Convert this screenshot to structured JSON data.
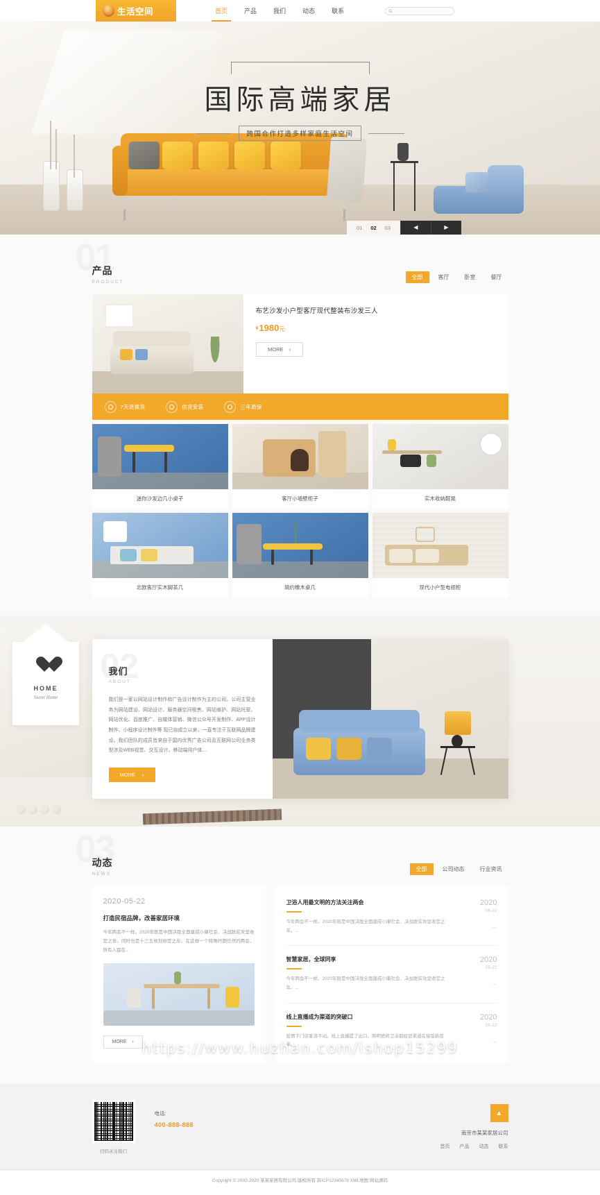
{
  "header": {
    "logo_text": "生活空间",
    "nav": [
      {
        "label": "首页",
        "active": true
      },
      {
        "label": "产品",
        "active": false
      },
      {
        "label": "我们",
        "active": false
      },
      {
        "label": "动态",
        "active": false
      },
      {
        "label": "联系",
        "active": false
      }
    ],
    "search_placeholder": ""
  },
  "hero": {
    "title": "国际高端家居",
    "subtitle": "跨国合作打造多样家庭生活空间",
    "carousel": {
      "slides": [
        "01",
        "02",
        "03"
      ],
      "active": "02",
      "prev_label": "◀",
      "next_label": "▶"
    }
  },
  "product": {
    "ghost": "01",
    "cn": "产品",
    "en": "PRODUCT",
    "tabs": [
      {
        "label": "全部",
        "active": true
      },
      {
        "label": "客厅",
        "active": false
      },
      {
        "label": "卧室",
        "active": false
      },
      {
        "label": "餐厅",
        "active": false
      }
    ],
    "featured": {
      "title": "布艺沙发小户型客厅现代整装布沙发三人",
      "currency": "¥",
      "price": "1980",
      "unit": "元",
      "more_label": "MORE",
      "more_arrow": "›"
    },
    "features": [
      {
        "label": "7天退换货"
      },
      {
        "label": "供货安装"
      },
      {
        "label": "三年质保"
      }
    ],
    "items": [
      {
        "caption": "迷你沙发边几小桌子"
      },
      {
        "caption": "客厅小墙壁柜子"
      },
      {
        "caption": "实木收纳鞋凳"
      },
      {
        "caption": "北欧客厅实木脚茶几"
      },
      {
        "caption": "简约橡木桌几"
      },
      {
        "caption": "现代小户型电视柜"
      }
    ]
  },
  "about": {
    "ghost": "02",
    "cn": "我们",
    "en": "ABOUT",
    "text": "我们是一家以网站设计制作和广告设计制作为主的公司。公司主营业务为网站建设、网站设计、服务器空间租售、网站维护、网站托管、网站优化、百度推广、自媒体营销、微信公众号开发制作、APP设计制作、小程序设计制作等 现已自成立以来，一直专注于互联网品牌建设。我们团队的成员皆来自于国内优秀广告公司及互联网公司业务类型涉及WEB视觉、交互设计、移动端用户体...",
    "more_label": "MORE",
    "more_arrow": "›",
    "deco": {
      "home": "HOME",
      "sweet": "Sweet Home"
    }
  },
  "news": {
    "ghost": "03",
    "cn": "动态",
    "en": "NEWS",
    "tabs": [
      {
        "label": "全部",
        "active": true
      },
      {
        "label": "公司动态",
        "active": false
      },
      {
        "label": "行业资讯",
        "active": false
      }
    ],
    "featured": {
      "date": "2020-05-22",
      "title": "打造民宿品牌，改善家居环境",
      "desc": "今年两会不一样。2020年既是中国决胜全面建成小康社会、决战脱贫攻坚收官之年，同时也是十三五规划收官之年。在这样一个特殊时期任然的两会，所有人都在...",
      "more_label": "MORE",
      "more_arrow": "›"
    },
    "items": [
      {
        "title": "卫浴人用最文明的方法关注两会",
        "desc": "今年两会不一样。2020年既是中国决胜全面建成小康社会、决战脱贫攻坚收官之年。...",
        "year": "2020",
        "md": "05-22",
        "arrow": "→"
      },
      {
        "title": "智慧家居，全球同享",
        "desc": "今年两会不一样。2020年既是中国决胜全面建成小康社会、决战脱贫攻坚收官之年。...",
        "year": "2020",
        "md": "05-22",
        "arrow": "→"
      },
      {
        "title": "线上直播成为渠道的突破口",
        "desc": "疫情下门店客流不动。线上直播提了出口。照明瓷砖卫浴都经营渠道在接受新变革。...",
        "year": "2020",
        "md": "05-22",
        "arrow": "→"
      }
    ]
  },
  "footer": {
    "qr_caption": "扫码关注我们",
    "tel_label": "电话:",
    "tel_number": "400-888-888",
    "back_to_top": "▲",
    "company": "南京市某某家居公司",
    "nav": [
      {
        "label": "首页"
      },
      {
        "label": "产品"
      },
      {
        "label": "动态"
      },
      {
        "label": "联系"
      }
    ],
    "copyright": "Copyright © 2002-2020 某某家居有限公司 版权所有 苏ICP12345678 XML地图 网站源码"
  },
  "watermark": "https://www.huzhan.com/ishop15299",
  "colors": {
    "brand": "#f3a829",
    "price": "#ef9a1f",
    "dark": "#2e2e2e"
  }
}
